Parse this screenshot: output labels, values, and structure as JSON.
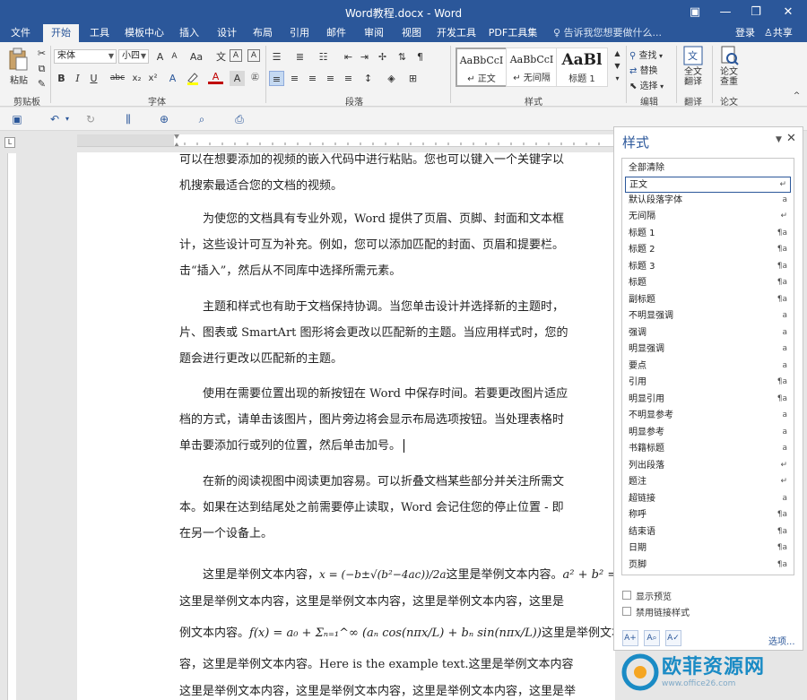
{
  "window": {
    "title": "Word教程.docx - Word",
    "colors": {
      "brand": "#2b579a",
      "ribbon_bg": "#f3f3f3",
      "page_bg": "#ffffff"
    }
  },
  "tabs": [
    {
      "label": "文件"
    },
    {
      "label": "开始"
    },
    {
      "label": "工具"
    },
    {
      "label": "模板中心"
    },
    {
      "label": "插入"
    },
    {
      "label": "设计"
    },
    {
      "label": "布局"
    },
    {
      "label": "引用"
    },
    {
      "label": "邮件"
    },
    {
      "label": "审阅"
    },
    {
      "label": "视图"
    },
    {
      "label": "开发工具"
    },
    {
      "label": "PDF工具集"
    }
  ],
  "active_tab": "开始",
  "tell_me_placeholder": "告诉我您想要做什么...",
  "sign_in": "登录",
  "share": "共享",
  "ribbon": {
    "clipboard": {
      "paste": "粘贴",
      "label": "剪贴板"
    },
    "font": {
      "family": "宋体",
      "size": "小四",
      "label": "字体",
      "bold": "B",
      "italic": "I",
      "underline": "U",
      "strike": "abc",
      "sub": "x₂",
      "sup": "x²",
      "grow": "A",
      "shrink": "A",
      "case": "Aa",
      "wen": "文"
    },
    "paragraph": {
      "label": "段落"
    },
    "styles": {
      "label": "样式",
      "items": [
        {
          "sample": "AaBbCcI",
          "name": "↵ 正文"
        },
        {
          "sample": "AaBbCcI",
          "name": "↵ 无间隔"
        },
        {
          "sample": "AaBl",
          "name": "标题 1"
        }
      ]
    },
    "editing": {
      "find": "查找",
      "replace": "替换",
      "select": "选择",
      "label": "编辑"
    },
    "translate": {
      "line1": "全文",
      "line2": "翻译",
      "label": "翻译"
    },
    "review": {
      "line1": "论文",
      "line2": "查重",
      "label": "论文"
    }
  },
  "document": {
    "paragraphs": [
      [
        "可以在想要添加的视频的嵌入代码中进行粘贴。您也可以键入一个关键字以",
        "机搜索最适合您的文档的视频。"
      ],
      [
        "　　为使您的文档具有专业外观，Word 提供了页眉、页脚、封面和文本框",
        "计，这些设计可互为补充。例如，您可以添加匹配的封面、页眉和提要栏。",
        "击“插入”，然后从不同库中选择所需元素。"
      ],
      [
        "　　主题和样式也有助于文档保持协调。当您单击设计并选择新的主题时，",
        "片、图表或 SmartArt 图形将会更改以匹配新的主题。当应用样式时，您的",
        "题会进行更改以匹配新的主题。"
      ],
      [
        "　　使用在需要位置出现的新按钮在 Word 中保存时间。若要更改图片适应",
        "档的方式，请单击该图片，图片旁边将会显示布局选项按钮。当处理表格时",
        "单击要添加行或列的位置，然后单击加号。"
      ],
      [
        "　　在新的阅读视图中阅读更加容易。可以折叠文档某些部分并关注所需文",
        "本。如果在达到结尾处之前需要停止读取，Word 会记住您的停止位置 - 即",
        "在另一个设备上。"
      ]
    ],
    "math_block": {
      "line1_pre": "　　这里是举例文本内容，",
      "formula1": "x = (−b±√(b²−4ac))/2a",
      "line1_mid": "这里是举例文本内容。",
      "formula2": "a² + b² =",
      "line2": "这里是举例文本内容，这里是举例文本内容，这里是举例文本内容，这里是",
      "line3_pre": "例文本内容。",
      "formula3": "f(x) = a₀ + Σₙ₌₁^∞ (aₙ cos(nπx/L) + bₙ sin(nπx/L))",
      "line3_post": "这里是举例文本内",
      "line4": "容，这里是举例文本内容。Here is the example text.这里是举例文本内容",
      "line5": "这里是举例文本内容，这里是举例文本内容，这里是举例文本内容，这里是举"
    }
  },
  "styles_pane": {
    "title": "样式",
    "items": [
      {
        "name": "全部清除",
        "mark": ""
      },
      {
        "name": "正文",
        "mark": "↵"
      },
      {
        "name": "默认段落字体",
        "mark": "a"
      },
      {
        "name": "无间隔",
        "mark": "↵"
      },
      {
        "name": "标题 1",
        "mark": "¶a"
      },
      {
        "name": "标题 2",
        "mark": "¶a"
      },
      {
        "name": "标题 3",
        "mark": "¶a"
      },
      {
        "name": "标题",
        "mark": "¶a"
      },
      {
        "name": "副标题",
        "mark": "¶a"
      },
      {
        "name": "不明显强调",
        "mark": "a"
      },
      {
        "name": "强调",
        "mark": "a"
      },
      {
        "name": "明显强调",
        "mark": "a"
      },
      {
        "name": "要点",
        "mark": "a"
      },
      {
        "name": "引用",
        "mark": "¶a"
      },
      {
        "name": "明显引用",
        "mark": "¶a"
      },
      {
        "name": "不明显参考",
        "mark": "a"
      },
      {
        "name": "明显参考",
        "mark": "a"
      },
      {
        "name": "书籍标题",
        "mark": "a"
      },
      {
        "name": "列出段落",
        "mark": "↵"
      },
      {
        "name": "题注",
        "mark": "↵"
      },
      {
        "name": "超链接",
        "mark": "a"
      },
      {
        "name": "称呼",
        "mark": "¶a"
      },
      {
        "name": "结束语",
        "mark": "¶a"
      },
      {
        "name": "日期",
        "mark": "¶a"
      },
      {
        "name": "页脚",
        "mark": "¶a"
      }
    ],
    "selected": "正文",
    "show_preview": "显示预览",
    "disable_linked": "禁用链接样式",
    "options": "选项..."
  },
  "watermark": {
    "text": "欧菲资源网",
    "url": "www.office26.com"
  }
}
